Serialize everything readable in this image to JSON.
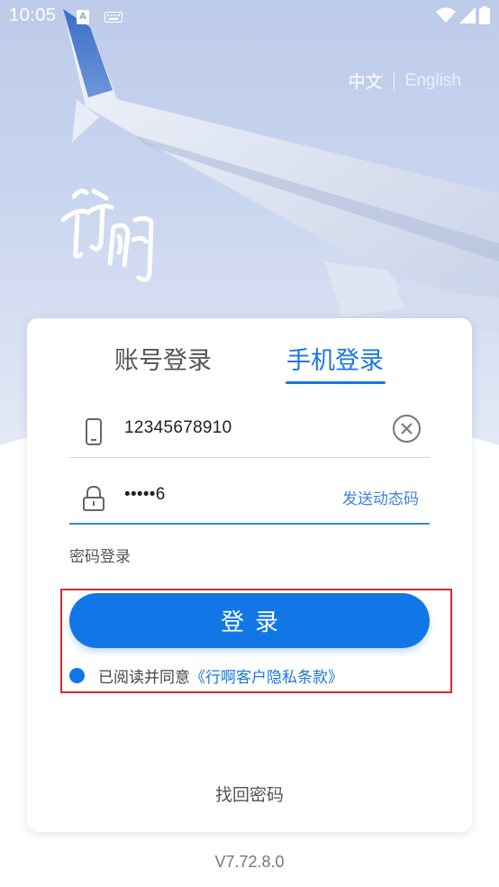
{
  "status_bar": {
    "time": "10:05",
    "notif_letter": "A",
    "icons": [
      "text-notification-icon",
      "keyboard-icon",
      "wifi-icon",
      "signal-icon",
      "battery-icon"
    ]
  },
  "language": {
    "chinese": "中文",
    "english": "English"
  },
  "logo": {
    "text": "行啊"
  },
  "tabs": [
    {
      "label": "账号登录",
      "active": false
    },
    {
      "label": "手机登录",
      "active": true
    }
  ],
  "form": {
    "phone_value": "12345678910",
    "code_value": "•••••6",
    "send_code_label": "发送动态码",
    "password_login_label": "密码登录",
    "login_button_label": "登录"
  },
  "agreement": {
    "text": "已阅读并同意",
    "link": "《行啊客户隐私条款》"
  },
  "forgot_password_label": "找回密码",
  "version": "V7.72.8.0",
  "colors": {
    "accent": "#1277e6",
    "link": "#1a78e0",
    "annotation": "#d72b2b"
  }
}
